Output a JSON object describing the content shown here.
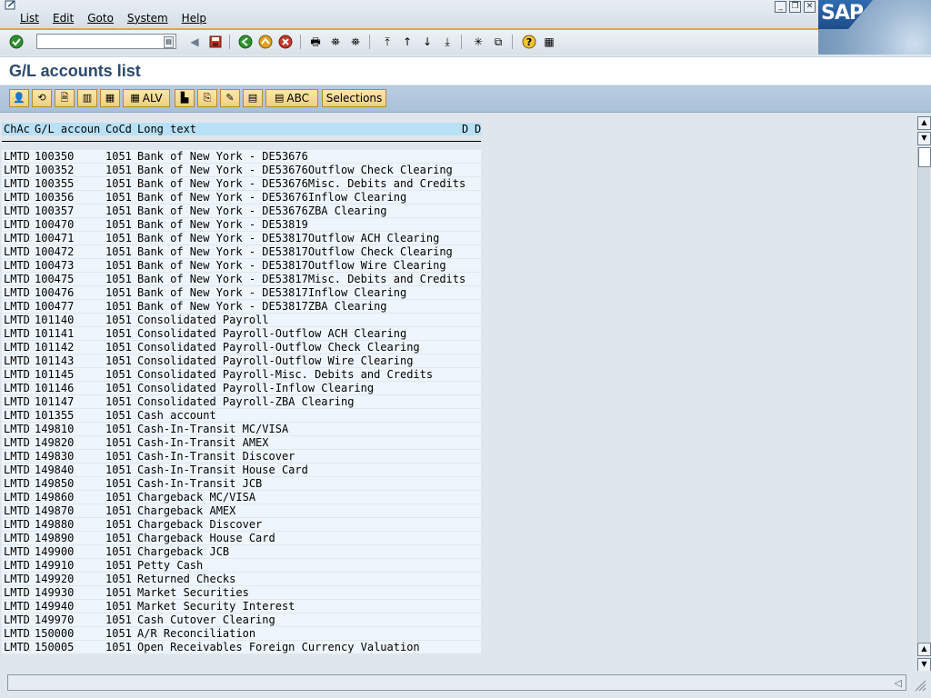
{
  "menu": {
    "items": [
      "List",
      "Edit",
      "Goto",
      "System",
      "Help"
    ]
  },
  "logo": {
    "text": "SAP"
  },
  "command_field": {
    "value": ""
  },
  "title": "G/L accounts list",
  "app_toolbar": {
    "alv_label": "ALV",
    "abc_label": "ABC",
    "selections_label": "Selections"
  },
  "list": {
    "headers": {
      "chac": "ChAc",
      "gl_account": "G/L accoun",
      "cocd": "CoCd",
      "long_text": "Long text",
      "d1": "D",
      "d2": "D"
    },
    "rows": [
      {
        "chac": "LMTD",
        "gl": "100350",
        "cocd": "1051",
        "text": "Bank of New York - DE53676"
      },
      {
        "chac": "LMTD",
        "gl": "100352",
        "cocd": "1051",
        "text": "Bank of New York - DE53676Outflow Check Clearing"
      },
      {
        "chac": "LMTD",
        "gl": "100355",
        "cocd": "1051",
        "text": "Bank of New York - DE53676Misc. Debits and Credits"
      },
      {
        "chac": "LMTD",
        "gl": "100356",
        "cocd": "1051",
        "text": "Bank of New York - DE53676Inflow Clearing"
      },
      {
        "chac": "LMTD",
        "gl": "100357",
        "cocd": "1051",
        "text": "Bank of New York - DE53676ZBA Clearing"
      },
      {
        "chac": "LMTD",
        "gl": "100470",
        "cocd": "1051",
        "text": "Bank of New York - DE53819"
      },
      {
        "chac": "LMTD",
        "gl": "100471",
        "cocd": "1051",
        "text": "Bank of New York - DE53817Outflow ACH Clearing"
      },
      {
        "chac": "LMTD",
        "gl": "100472",
        "cocd": "1051",
        "text": "Bank of New York - DE53817Outflow Check Clearing"
      },
      {
        "chac": "LMTD",
        "gl": "100473",
        "cocd": "1051",
        "text": "Bank of New York - DE53817Outflow Wire Clearing"
      },
      {
        "chac": "LMTD",
        "gl": "100475",
        "cocd": "1051",
        "text": "Bank of New York - DE53817Misc. Debits and Credits"
      },
      {
        "chac": "LMTD",
        "gl": "100476",
        "cocd": "1051",
        "text": "Bank of New York - DE53817Inflow Clearing"
      },
      {
        "chac": "LMTD",
        "gl": "100477",
        "cocd": "1051",
        "text": "Bank of New York - DE53817ZBA Clearing"
      },
      {
        "chac": "LMTD",
        "gl": "101140",
        "cocd": "1051",
        "text": "Consolidated Payroll"
      },
      {
        "chac": "LMTD",
        "gl": "101141",
        "cocd": "1051",
        "text": "Consolidated Payroll-Outflow ACH Clearing"
      },
      {
        "chac": "LMTD",
        "gl": "101142",
        "cocd": "1051",
        "text": "Consolidated Payroll-Outflow Check Clearing"
      },
      {
        "chac": "LMTD",
        "gl": "101143",
        "cocd": "1051",
        "text": "Consolidated Payroll-Outflow Wire Clearing"
      },
      {
        "chac": "LMTD",
        "gl": "101145",
        "cocd": "1051",
        "text": "Consolidated Payroll-Misc. Debits and Credits"
      },
      {
        "chac": "LMTD",
        "gl": "101146",
        "cocd": "1051",
        "text": "Consolidated Payroll-Inflow Clearing"
      },
      {
        "chac": "LMTD",
        "gl": "101147",
        "cocd": "1051",
        "text": "Consolidated Payroll-ZBA Clearing"
      },
      {
        "chac": "LMTD",
        "gl": "101355",
        "cocd": "1051",
        "text": "Cash account"
      },
      {
        "chac": "LMTD",
        "gl": "149810",
        "cocd": "1051",
        "text": "Cash-In-Transit MC/VISA"
      },
      {
        "chac": "LMTD",
        "gl": "149820",
        "cocd": "1051",
        "text": "Cash-In-Transit AMEX"
      },
      {
        "chac": "LMTD",
        "gl": "149830",
        "cocd": "1051",
        "text": "Cash-In-Transit Discover"
      },
      {
        "chac": "LMTD",
        "gl": "149840",
        "cocd": "1051",
        "text": "Cash-In-Transit House Card"
      },
      {
        "chac": "LMTD",
        "gl": "149850",
        "cocd": "1051",
        "text": "Cash-In-Transit JCB"
      },
      {
        "chac": "LMTD",
        "gl": "149860",
        "cocd": "1051",
        "text": "Chargeback MC/VISA"
      },
      {
        "chac": "LMTD",
        "gl": "149870",
        "cocd": "1051",
        "text": "Chargeback AMEX"
      },
      {
        "chac": "LMTD",
        "gl": "149880",
        "cocd": "1051",
        "text": "Chargeback Discover"
      },
      {
        "chac": "LMTD",
        "gl": "149890",
        "cocd": "1051",
        "text": "Chargeback House Card"
      },
      {
        "chac": "LMTD",
        "gl": "149900",
        "cocd": "1051",
        "text": "Chargeback JCB"
      },
      {
        "chac": "LMTD",
        "gl": "149910",
        "cocd": "1051",
        "text": "Petty Cash"
      },
      {
        "chac": "LMTD",
        "gl": "149920",
        "cocd": "1051",
        "text": "Returned Checks"
      },
      {
        "chac": "LMTD",
        "gl": "149930",
        "cocd": "1051",
        "text": "Market Securities"
      },
      {
        "chac": "LMTD",
        "gl": "149940",
        "cocd": "1051",
        "text": "Market Security Interest"
      },
      {
        "chac": "LMTD",
        "gl": "149970",
        "cocd": "1051",
        "text": "Cash Cutover Clearing"
      },
      {
        "chac": "LMTD",
        "gl": "150000",
        "cocd": "1051",
        "text": "A/R Reconciliation"
      },
      {
        "chac": "LMTD",
        "gl": "150005",
        "cocd": "1051",
        "text": "Open Receivables Foreign Currency Valuation"
      }
    ]
  },
  "status": {
    "message": ""
  },
  "colors": {
    "title": "#2b4a6d",
    "header_row": "#b8e0f6",
    "list_row": "#eef5fb",
    "app_toolbar": "#a9c0d8",
    "orange_accent": "#e8a23c"
  }
}
